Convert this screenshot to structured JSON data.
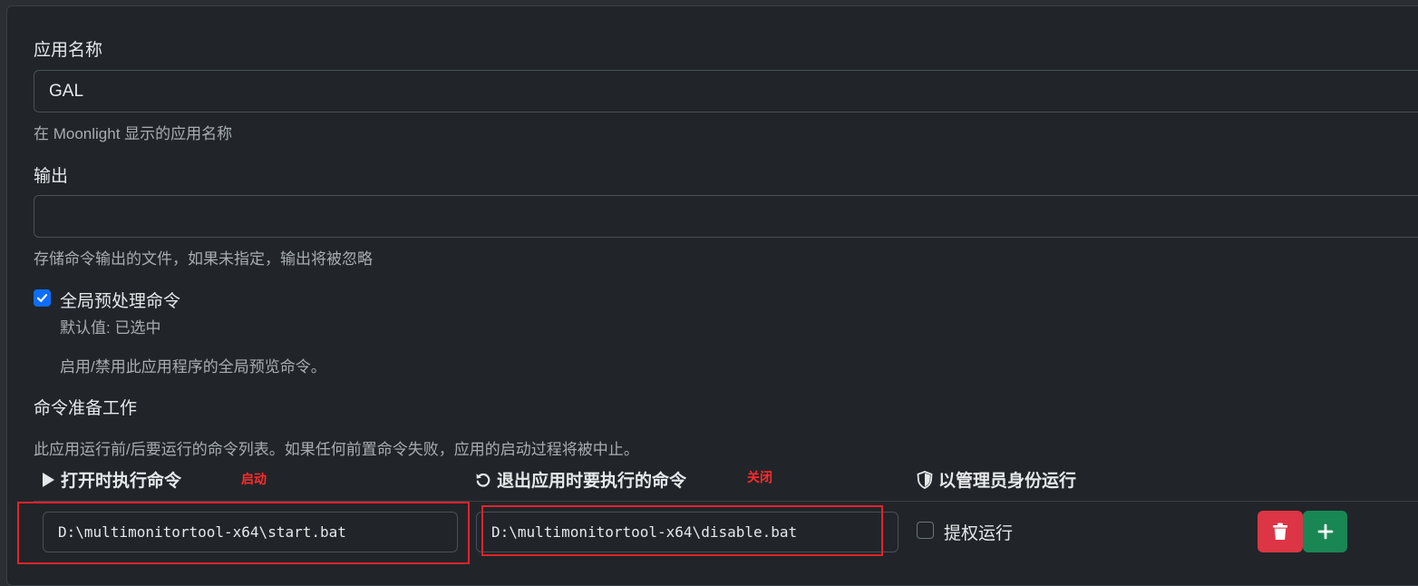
{
  "app_name": {
    "label": "应用名称",
    "value": "GAL",
    "help": "在 Moonlight 显示的应用名称"
  },
  "output": {
    "label": "输出",
    "value": "",
    "help": "存储命令输出的文件，如果未指定，输出将被忽略"
  },
  "global_prep": {
    "label": "全局预处理命令",
    "checked": true,
    "default_text": "默认值: 已选中",
    "description": "启用/禁用此应用程序的全局预览命令。"
  },
  "prep_cmd": {
    "title": "命令准备工作",
    "description": "此应用运行前/后要运行的命令列表。如果任何前置命令失败，应用的启动过程将被中止。",
    "columns": {
      "do": "打开时执行命令",
      "undo": "退出应用时要执行的命令",
      "elevated": "以管理员身份运行"
    },
    "annotations": {
      "do": "启动",
      "undo": "关闭"
    },
    "rows": [
      {
        "do": "D:\\multimonitortool-x64\\start.bat",
        "undo": "D:\\multimonitortool-x64\\disable.bat",
        "elevated_label": "提权运行",
        "elevated": false
      }
    ]
  },
  "colors": {
    "accent": "#0d6efd",
    "danger": "#dc3545",
    "success": "#198754",
    "annotation": "#e0242c"
  }
}
